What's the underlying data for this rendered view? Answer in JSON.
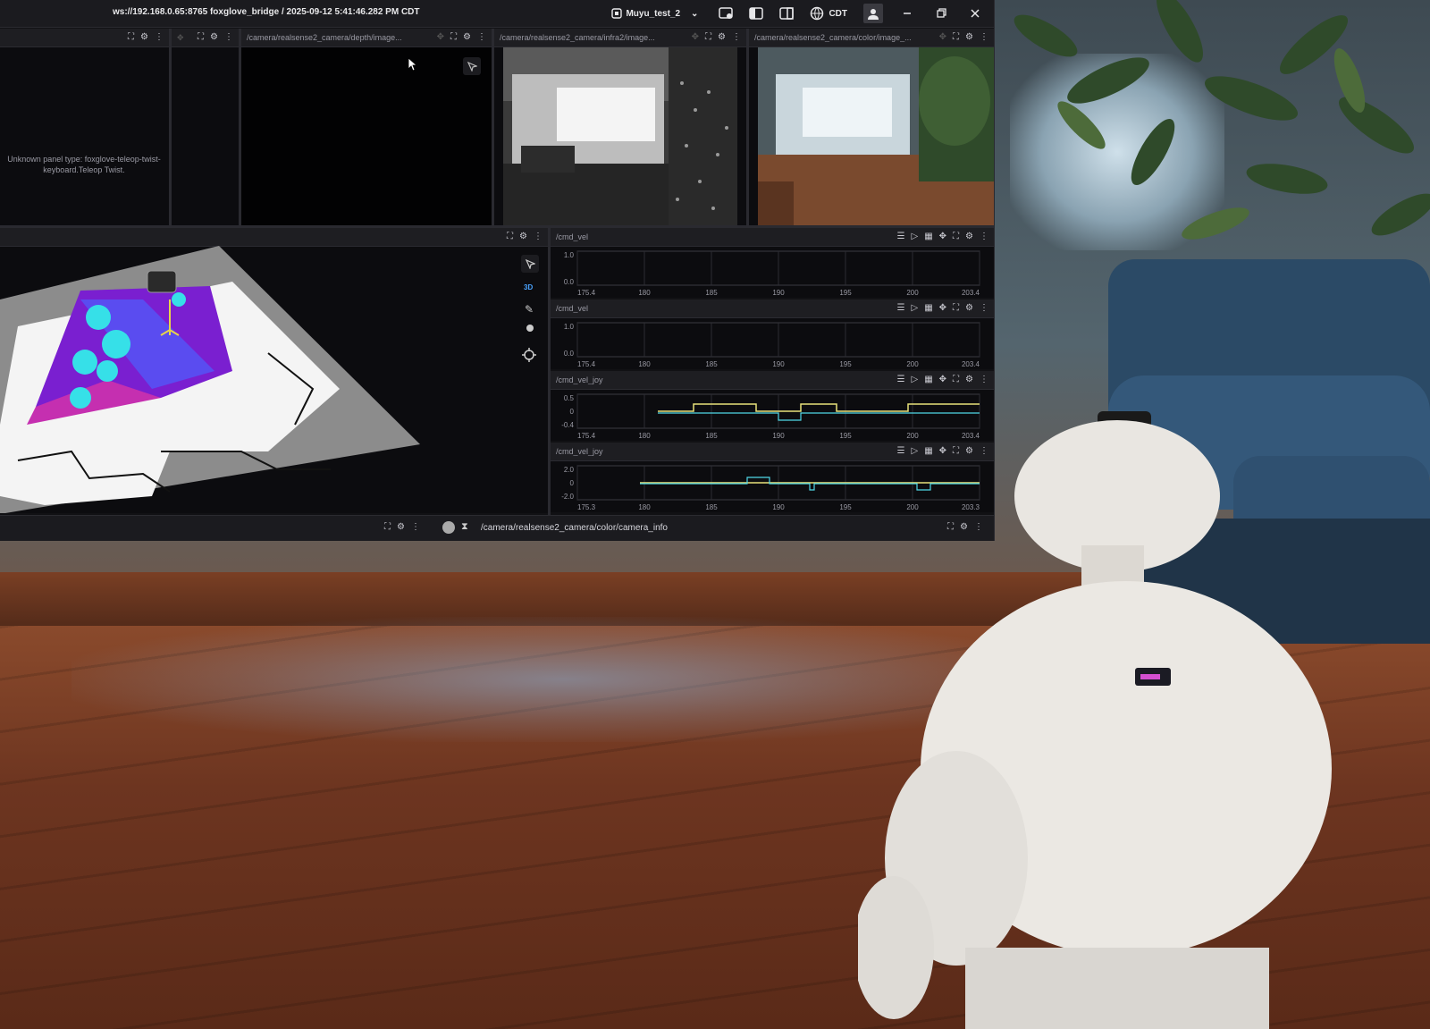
{
  "titlebar": {
    "connection": "ws://192.168.0.65:8765 foxglove_bridge / 2025-09-12 5:41:46.282 PM CDT",
    "project": "Muyu_test_2",
    "timezone": "CDT"
  },
  "panels": {
    "teleop": {
      "message": "Unknown panel type: foxglove-teleop-twist-keyboard.Teleop Twist."
    },
    "depth": {
      "title": "/camera/realsense2_camera/depth/image..."
    },
    "infra": {
      "title": "/camera/realsense2_camera/infra2/image..."
    },
    "color": {
      "title": "/camera/realsense2_camera/color/image_..."
    },
    "view3d": {
      "mode_label": "3D"
    }
  },
  "plots": [
    {
      "title": "/cmd_vel",
      "yticks": [
        "1.0",
        "0.0"
      ],
      "xticks": [
        "175.4",
        "180",
        "185",
        "190",
        "195",
        "200",
        "203.4"
      ]
    },
    {
      "title": "/cmd_vel",
      "yticks": [
        "1.0",
        "0.0"
      ],
      "xticks": [
        "175.4",
        "180",
        "185",
        "190",
        "195",
        "200",
        "203.4"
      ]
    },
    {
      "title": "/cmd_vel_joy",
      "yticks": [
        "0.5",
        "0",
        "-0.4"
      ],
      "xticks": [
        "175.4",
        "180",
        "185",
        "190",
        "195",
        "200",
        "203.4"
      ]
    },
    {
      "title": "/cmd_vel_joy",
      "yticks": [
        "2.0",
        "0",
        "-2.0"
      ],
      "xticks": [
        "175.3",
        "180",
        "185",
        "190",
        "195",
        "200",
        "203.3"
      ]
    }
  ],
  "statusbar": {
    "topic": "/camera/realsense2_camera/color/camera_info"
  },
  "colors": {
    "accent_yellow": "#e8e27a",
    "accent_cyan": "#4fd8e8",
    "panel_bg": "#0c0c0f"
  }
}
